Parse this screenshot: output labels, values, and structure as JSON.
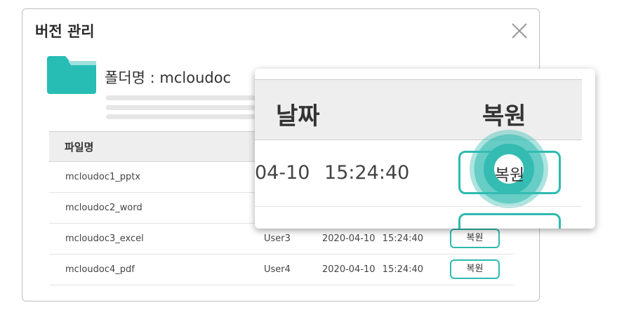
{
  "dialog": {
    "title": "버전 관리",
    "close_icon": "close-icon",
    "folder": {
      "icon": "folder-icon",
      "label": "폴더명 : mcloudoc",
      "color": "#27bdb5"
    }
  },
  "table": {
    "header": {
      "file_name": "파일명"
    },
    "rows": [
      {
        "file": "mcloudoc1_pptx",
        "user": "",
        "datetime": "",
        "restore": ""
      },
      {
        "file": "mcloudoc2_word",
        "user": "",
        "datetime": "",
        "restore": ""
      },
      {
        "file": "mcloudoc3_excel",
        "user": "User3",
        "datetime": "2020-04-10 15:24:40",
        "restore": "복원"
      },
      {
        "file": "mcloudoc4_pdf",
        "user": "User4",
        "datetime": "2020-04-10 15:24:40",
        "restore": "복원"
      }
    ]
  },
  "zoom": {
    "date_header": "날짜",
    "restore_header": "복원",
    "datetime": "04-10 15:24:40",
    "restore_button": "복원"
  },
  "colors": {
    "accent": "#2ebab0",
    "header_bg": "#eeeeee"
  }
}
